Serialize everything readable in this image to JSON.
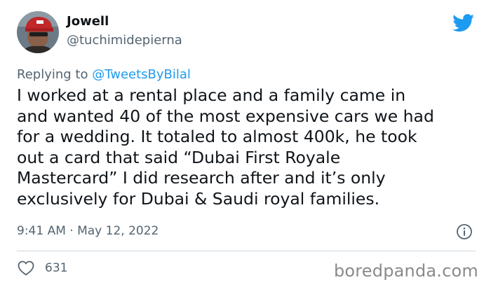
{
  "author": {
    "display_name": "Jowell",
    "handle": "@tuchimidepierna",
    "avatar_icon": "user-avatar"
  },
  "reply": {
    "prefix": "Replying to ",
    "target": "@TweetsByBilal"
  },
  "tweet": {
    "lines": [
      "I worked at a rental place and a family came in",
      "and wanted 40 of the most expensive cars we had",
      "for a wedding. It totaled to almost 400k, he took",
      "out a card that said “Dubai First Royale",
      "Mastercard” I did research after and it’s only",
      "exclusively for Dubai & Saudi royal families."
    ],
    "timestamp": "9:41 AM · May 12, 2022"
  },
  "engagement": {
    "like_count": "631",
    "like_icon": "heart-icon"
  },
  "icons": {
    "platform": "twitter-bird-icon",
    "info": "info-icon"
  },
  "watermark": "boredpanda.com",
  "colors": {
    "brand_blue": "#1d9bf0",
    "secondary_text": "#536471",
    "primary_text": "#0f1419",
    "divider": "#cfd9de"
  }
}
